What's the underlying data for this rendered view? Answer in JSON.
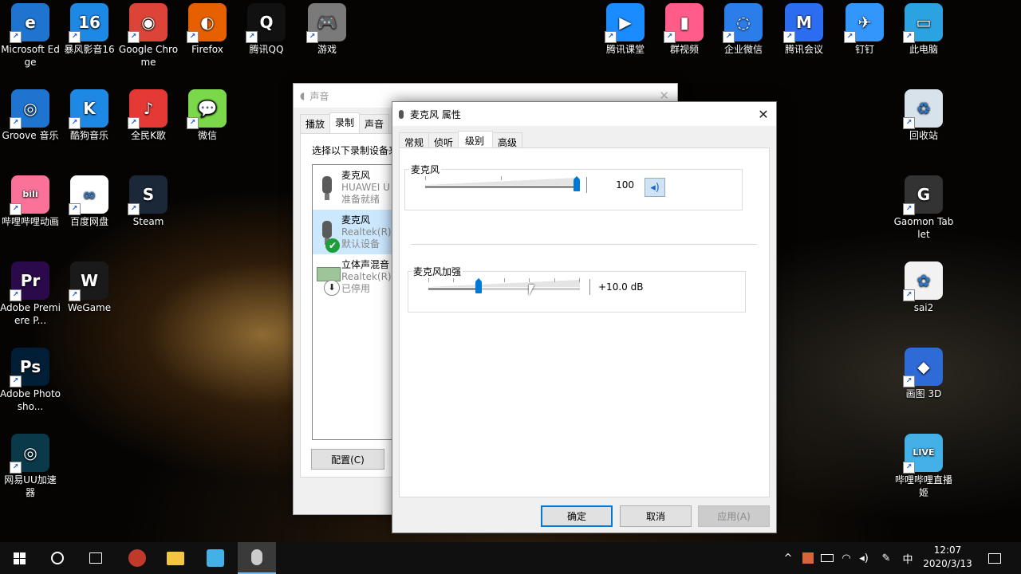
{
  "desktop": {
    "left_icons": [
      {
        "label": "Microsoft Edge",
        "color": "#1f74d0",
        "glyph": "e",
        "icon": "edge-icon"
      },
      {
        "label": "暴风影音16",
        "color": "#1e88e5",
        "glyph": "16",
        "icon": "baofeng-icon"
      },
      {
        "label": "Google Chrome",
        "color": "#db4437",
        "glyph": "◉",
        "icon": "chrome-icon"
      },
      {
        "label": "Firefox",
        "color": "#e66000",
        "glyph": "◐",
        "icon": "firefox-icon"
      },
      {
        "label": "腾讯QQ",
        "color": "#111111",
        "glyph": "Q",
        "icon": "qq-icon"
      },
      {
        "label": "游戏",
        "color": "#7a7a7a",
        "glyph": "🎮",
        "icon": "game-controller-icon"
      },
      {
        "label": "Groove 音乐",
        "color": "#1f74d0",
        "glyph": "◎",
        "icon": "groove-icon"
      },
      {
        "label": "酷狗音乐",
        "color": "#1e88e5",
        "glyph": "K",
        "icon": "kugou-icon"
      },
      {
        "label": "全民K歌",
        "color": "#e53935",
        "glyph": "♪",
        "icon": "kge-icon"
      },
      {
        "label": "微信",
        "color": "#7bd84a",
        "glyph": "💬",
        "icon": "wechat-icon"
      },
      {
        "label": "哔哩哔哩动画",
        "color": "#fb7299",
        "glyph": "bili",
        "icon": "bilibili-icon"
      },
      {
        "label": "百度网盘",
        "color": "#ffffff",
        "glyph": "∞",
        "icon": "baidu-netdisk-icon"
      },
      {
        "label": "Steam",
        "color": "#1b2838",
        "glyph": "S",
        "icon": "steam-icon"
      },
      {
        "label": "Adobe Premiere P...",
        "color": "#2a0a4a",
        "glyph": "Pr",
        "icon": "premiere-icon"
      },
      {
        "label": "WeGame",
        "color": "#1a1a1a",
        "glyph": "W",
        "icon": "wegame-icon"
      },
      {
        "label": "Adobe Photosho...",
        "color": "#001e36",
        "glyph": "Ps",
        "icon": "photoshop-icon"
      },
      {
        "label": "网易UU加速器",
        "color": "#0a3a4a",
        "glyph": "◎",
        "icon": "uu-icon"
      }
    ],
    "right_icons": [
      {
        "label": "腾讯课堂",
        "color": "#1a8cff",
        "glyph": "▶",
        "icon": "tencent-classroom-icon"
      },
      {
        "label": "群视频",
        "color": "#ff5c8a",
        "glyph": "▮",
        "icon": "group-video-icon"
      },
      {
        "label": "企业微信",
        "color": "#2b7de9",
        "glyph": "◌",
        "icon": "wecom-icon"
      },
      {
        "label": "腾讯会议",
        "color": "#2b6cf0",
        "glyph": "M",
        "icon": "tencent-meeting-icon"
      },
      {
        "label": "钉钉",
        "color": "#3296fa",
        "glyph": "✈",
        "icon": "dingtalk-icon"
      },
      {
        "label": "此电脑",
        "color": "#2aa3e0",
        "glyph": "▭",
        "icon": "this-pc-icon"
      },
      {
        "label": "回收站",
        "color": "#d8e2ea",
        "glyph": "♻",
        "icon": "recycle-bin-icon"
      },
      {
        "label": "Gaomon Tablet",
        "color": "#333333",
        "glyph": "G",
        "icon": "gaomon-icon"
      },
      {
        "label": "sai2",
        "color": "#f2f2f2",
        "glyph": "✿",
        "icon": "sai2-icon"
      },
      {
        "label": "画图 3D",
        "color": "#2e6bd6",
        "glyph": "◆",
        "icon": "paint3d-icon"
      },
      {
        "label": "哔哩哔哩直播姬",
        "color": "#43b0e8",
        "glyph": "LIVE",
        "icon": "bilibili-live-icon"
      }
    ]
  },
  "sound_dialog": {
    "title": "声音",
    "tabs": [
      "播放",
      "录制",
      "声音"
    ],
    "hint": "选择以下录制设备来",
    "devices": [
      {
        "name": "麦克风",
        "driver": "HUAWEI U",
        "status": "准备就绪"
      },
      {
        "name": "麦克风",
        "driver": "Realtek(R)",
        "status": "默认设备"
      },
      {
        "name": "立体声混音",
        "driver": "Realtek(R)",
        "status": "已停用"
      }
    ],
    "configure_button": "配置(C)"
  },
  "mic_properties": {
    "title": "麦克风 属性",
    "close_glyph": "✕",
    "tabs": [
      "常规",
      "侦听",
      "级别",
      "高级"
    ],
    "active_tab": "级别",
    "mic_group": {
      "label": "麦克风",
      "value": "100",
      "level_fraction": 1.0
    },
    "boost_group": {
      "label": "麦克风加强",
      "value": "+10.0 dB",
      "level_fraction": 0.33
    },
    "buttons": {
      "ok": "确定",
      "cancel": "取消",
      "apply": "应用(A)"
    }
  },
  "taskbar": {
    "ime": "中",
    "time": "12:07",
    "date": "2020/3/13"
  }
}
